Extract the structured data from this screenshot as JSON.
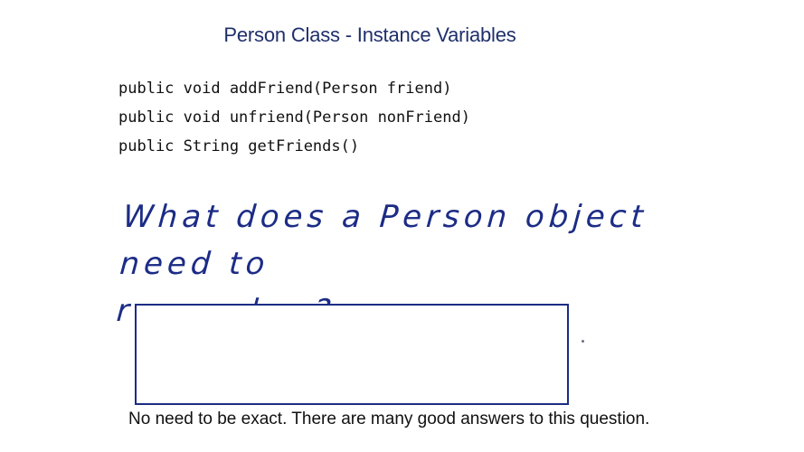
{
  "slide": {
    "title": "Person Class - Instance Variables",
    "code_lines": [
      "public void addFriend(Person friend)",
      "public void unfriend(Person nonFriend)",
      "public String getFriends()"
    ],
    "question": {
      "line1": "What does a Person object need to",
      "line2": "remember?"
    },
    "answer_box": {
      "value": ""
    },
    "hint": "No need to be exact. There are many good answers to this question."
  },
  "colors": {
    "title": "#1f2f6b",
    "handwriting": "#1c2c86",
    "code": "#111111"
  }
}
